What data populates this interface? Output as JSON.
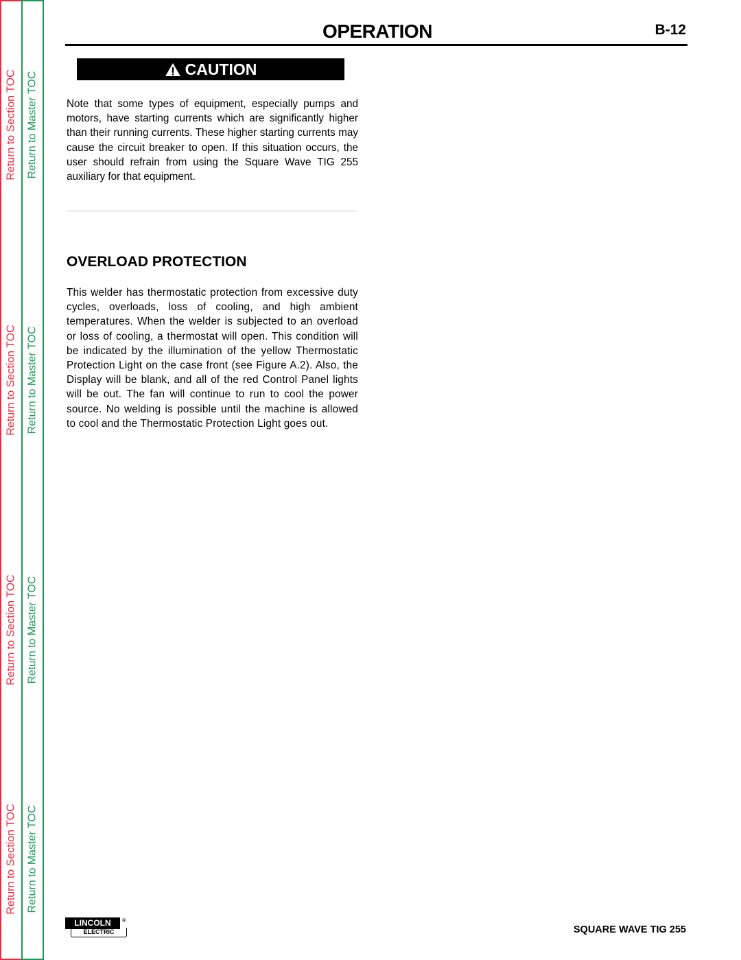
{
  "sidebar": {
    "section_toc_label": "Return to Section TOC",
    "master_toc_label": "Return to Master TOC",
    "section_color": "#ee2a3f",
    "master_color": "#1a9b57"
  },
  "header": {
    "title": "OPERATION",
    "page_number": "B-12"
  },
  "caution": {
    "icon": "warning-triangle-icon",
    "label": "CAUTION",
    "text": "Note that some types of equipment, especially pumps and motors, have starting currents which are significantly higher than their running currents. These higher starting currents may cause the circuit breaker to open. If this situation occurs, the user should refrain from using the Square Wave TIG 255 auxiliary for that equipment."
  },
  "overload": {
    "heading": "OVERLOAD PROTECTION",
    "text": "This welder has thermostatic protection from excessive duty cycles, overloads, loss of cooling, and high ambient temperatures. When the welder is subjected to an overload or loss of cooling, a thermostat will open. This condition will be indicated by the illumination of the yellow Thermostatic Protection Light on the case front (see Figure A.2). Also, the Display will be blank, and all of the red Control Panel lights will be out. The fan will continue to run to cool the power source. No welding is possible until the machine is allowed to cool and the Thermostatic Protection Light goes out."
  },
  "footer": {
    "logo_top": "LINCOLN",
    "logo_reg": "®",
    "logo_bottom": "ELECTRIC",
    "model": "SQUARE WAVE TIG 255"
  }
}
